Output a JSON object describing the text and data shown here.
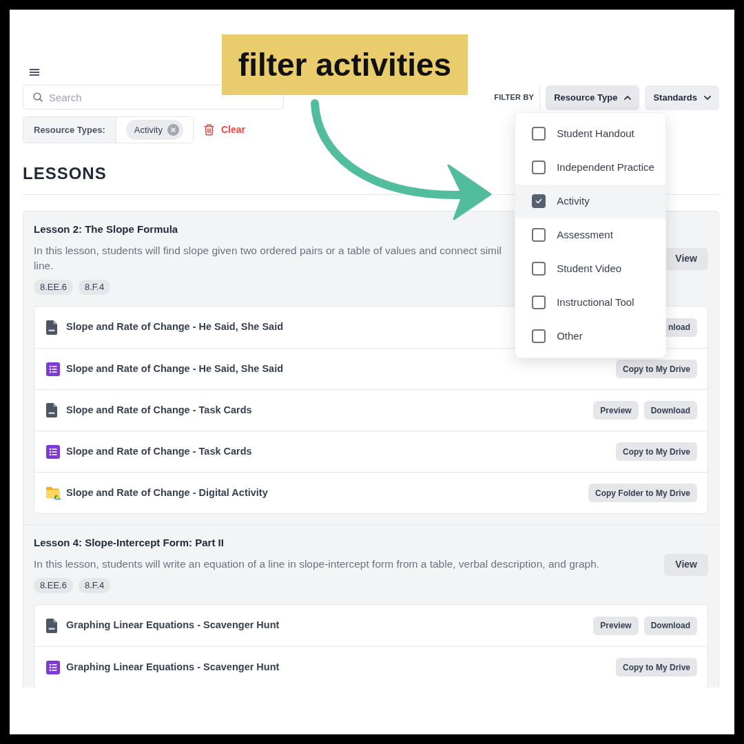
{
  "callout": {
    "text": "filter activities"
  },
  "search": {
    "placeholder": "Search"
  },
  "active_filters": {
    "label": "Resource Types:",
    "chips": [
      "Activity"
    ],
    "clear": "Clear"
  },
  "filter_bar": {
    "label": "FILTER BY",
    "buttons": [
      {
        "label": "Resource Type",
        "expanded": true,
        "options": [
          {
            "label": "Student Handout",
            "checked": false,
            "hovered": false
          },
          {
            "label": "Independent Practice",
            "checked": false,
            "hovered": false
          },
          {
            "label": "Activity",
            "checked": true,
            "hovered": true
          },
          {
            "label": "Assessment",
            "checked": false,
            "hovered": false
          },
          {
            "label": "Student Video",
            "checked": false,
            "hovered": false
          },
          {
            "label": "Instructional Tool",
            "checked": false,
            "hovered": false
          },
          {
            "label": "Other",
            "checked": false,
            "hovered": false
          }
        ]
      },
      {
        "label": "Standards",
        "expanded": false
      }
    ]
  },
  "section_title": "LESSONS",
  "lessons": [
    {
      "title": "Lesson 2: The Slope Formula",
      "description": [
        "In this lesson, students will find slope given two ordered pairs or a table of values and connect simil",
        "line."
      ],
      "view": "View",
      "standards": [
        "8.EE.6",
        "8.F.4"
      ],
      "resources": [
        {
          "kind": "pdf",
          "title": "Slope and Rate of Change - He Said, She Said",
          "buttons": [
            "nload"
          ]
        },
        {
          "kind": "form",
          "title": "Slope and Rate of Change - He Said, She Said",
          "buttons": [
            "Copy to My Drive"
          ]
        },
        {
          "kind": "pdf",
          "title": "Slope and Rate of Change - Task Cards",
          "buttons": [
            "Preview",
            "Download"
          ]
        },
        {
          "kind": "form",
          "title": "Slope and Rate of Change - Task Cards",
          "buttons": [
            "Copy to My Drive"
          ]
        },
        {
          "kind": "folder",
          "title": "Slope and Rate of Change - Digital Activity",
          "buttons": [
            "Copy Folder to My Drive"
          ]
        }
      ]
    },
    {
      "title": "Lesson 4: Slope-Intercept Form: Part II",
      "description": [
        "In this lesson, students will write an equation of a line in slope-intercept form from a table, verbal description, and graph."
      ],
      "view": "View",
      "standards": [
        "8.EE.6",
        "8.F.4"
      ],
      "resources": [
        {
          "kind": "pdf",
          "title": "Graphing Linear Equations - Scavenger Hunt",
          "buttons": [
            "Preview",
            "Download"
          ]
        },
        {
          "kind": "form",
          "title": "Graphing Linear Equations - Scavenger Hunt",
          "buttons": [
            "Copy to My Drive"
          ]
        }
      ]
    }
  ]
}
